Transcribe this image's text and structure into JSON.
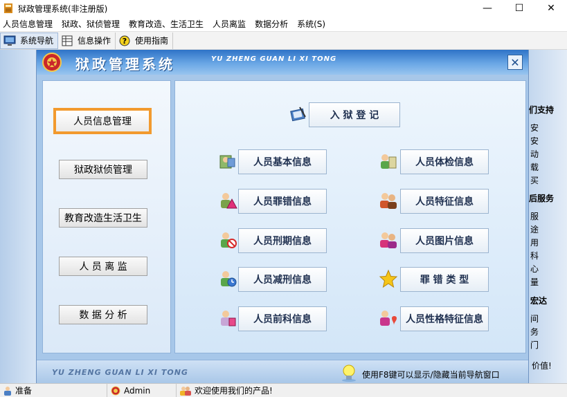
{
  "window": {
    "title": "狱政管理系统(非注册版)",
    "controls": [
      "—",
      "☐",
      "✕"
    ]
  },
  "menubar": [
    "人员信息管理",
    "狱政、狱侦管理",
    "教育改造、生活卫生",
    "人员离监",
    "数据分析",
    "系统(S)"
  ],
  "toolbar": {
    "nav": "系统导航",
    "info": "信息操作",
    "guide": "使用指南"
  },
  "dialog": {
    "title": "狱政管理系统",
    "pinyin": "YU ZHENG GUAN LI XI TONG",
    "close": "✕"
  },
  "nav": [
    "人员信息管理",
    "狱政狱侦管理",
    "教育改造生活卫生",
    "人 员 离 监",
    "数 据 分 析"
  ],
  "content": {
    "register": "入 狱 登 记",
    "buttons": [
      "人员基本信息",
      "人员体检信息",
      "人员罪错信息",
      "人员特征信息",
      "人员刑期信息",
      "人员图片信息",
      "人员减刑信息",
      "罪 错 类 型",
      "人员前科信息",
      "人员性格特征信息"
    ]
  },
  "footer": {
    "pinyin": "YU ZHENG GUAN LI XI TONG",
    "hint": "使用F8键可以显示/隐藏当前导航窗口"
  },
  "rightpanel": [
    "们支持",
    "安",
    "安",
    "动",
    "载",
    "买",
    "后服务",
    "服",
    "途",
    "用",
    "科",
    "心",
    "量",
    "宏达",
    "间",
    "务",
    "门",
    "价值!"
  ],
  "status": {
    "ready": "准备",
    "user": "Admin",
    "welcome": "欢迎使用我们的产品!"
  },
  "colors": {
    "accent_orange": "#f29a2e",
    "dialog_blue": "#2f73c7"
  }
}
